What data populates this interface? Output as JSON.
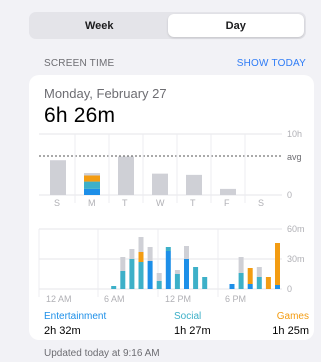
{
  "segmented": {
    "week": "Week",
    "day": "Day"
  },
  "header": {
    "label": "SCREEN TIME",
    "show_today": "SHOW TODAY"
  },
  "summary": {
    "date": "Monday, February 27",
    "total": "6h 26m"
  },
  "colors": {
    "entertainment": "#1d8fe8",
    "social": "#3db0c8",
    "games": "#f39c12",
    "other": "#cfd0d6",
    "accent": "#2f7cf6"
  },
  "weekly_chart": {
    "type": "bar",
    "days": [
      "S",
      "M",
      "T",
      "W",
      "T",
      "F",
      "S"
    ],
    "hours_total": [
      5.7,
      3.6,
      6.3,
      3.5,
      3.3,
      1.0,
      0
    ],
    "monday_breakdown": {
      "entertainment": 1.0,
      "social": 1.2,
      "games": 1.0,
      "other": 0.4
    },
    "y_ticks": {
      "top": "10h",
      "avg": "avg",
      "zero": "0"
    },
    "avg_hours": 6.3
  },
  "hourly_chart": {
    "type": "bar",
    "x_ticks": [
      "12 AM",
      "6 AM",
      "12 PM",
      "6 PM"
    ],
    "y_ticks": {
      "top": "60m",
      "mid": "30m",
      "zero": "0"
    },
    "hours": [
      {
        "ent": 0,
        "soc": 0,
        "games": 0,
        "other": 0
      },
      {
        "ent": 0,
        "soc": 0,
        "games": 0,
        "other": 0
      },
      {
        "ent": 0,
        "soc": 3,
        "games": 0,
        "other": 0
      },
      {
        "ent": 0,
        "soc": 18,
        "games": 0,
        "other": 14
      },
      {
        "ent": 0,
        "soc": 30,
        "games": 0,
        "other": 10
      },
      {
        "ent": 0,
        "soc": 27,
        "games": 10,
        "other": 15
      },
      {
        "ent": 28,
        "soc": 0,
        "games": 0,
        "other": 14
      },
      {
        "ent": 0,
        "soc": 8,
        "games": 0,
        "other": 8
      },
      {
        "ent": 38,
        "soc": 4,
        "games": 0,
        "other": 0
      },
      {
        "ent": 0,
        "soc": 15,
        "games": 0,
        "other": 4
      },
      {
        "ent": 30,
        "soc": 0,
        "games": 0,
        "other": 13
      },
      {
        "ent": 0,
        "soc": 22,
        "games": 0,
        "other": 0
      },
      {
        "ent": 0,
        "soc": 12,
        "games": 0,
        "other": 0
      },
      {
        "ent": 0,
        "soc": 0,
        "games": 0,
        "other": 0
      },
      {
        "ent": 0,
        "soc": 0,
        "games": 0,
        "other": 0
      },
      {
        "ent": 5,
        "soc": 0,
        "games": 0,
        "other": 0
      },
      {
        "ent": 0,
        "soc": 16,
        "games": 0,
        "other": 16
      },
      {
        "ent": 5,
        "soc": 0,
        "games": 16,
        "other": 0
      },
      {
        "ent": 0,
        "soc": 12,
        "games": 0,
        "other": 10
      },
      {
        "ent": 0,
        "soc": 0,
        "games": 12,
        "other": 0
      },
      {
        "ent": 4,
        "soc": 0,
        "games": 42,
        "other": 0
      }
    ]
  },
  "legend": [
    {
      "name": "Entertainment",
      "value": "2h 32m"
    },
    {
      "name": "Social",
      "value": "1h 27m"
    },
    {
      "name": "Games",
      "value": "1h 25m"
    }
  ],
  "footer": {
    "updated": "Updated today at 9:16 AM"
  }
}
